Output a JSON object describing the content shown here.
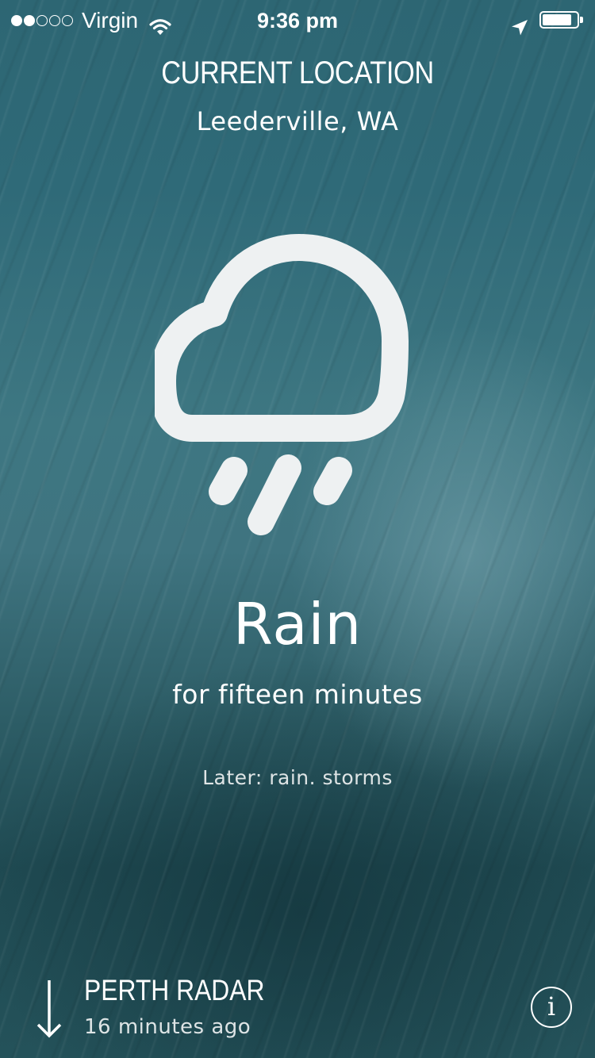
{
  "status_bar": {
    "signal_bars_filled": 2,
    "signal_bars_total": 5,
    "carrier": "Virgin",
    "time": "9:36 pm",
    "battery_level": 0.85
  },
  "header": {
    "heading": "CURRENT LOCATION",
    "location": "Leederville, WA"
  },
  "weather": {
    "icon": "rain-cloud-icon",
    "condition": "Rain",
    "duration": "for fifteen minutes",
    "later": "Later: rain. storms"
  },
  "footer": {
    "radar_title": "PERTH RADAR",
    "radar_updated": "16 minutes ago",
    "info_label": "i"
  },
  "colors": {
    "background_top": "#2d6673",
    "background_bottom": "#24525a",
    "foreground": "#ffffff",
    "icon": "#eef1f2"
  }
}
